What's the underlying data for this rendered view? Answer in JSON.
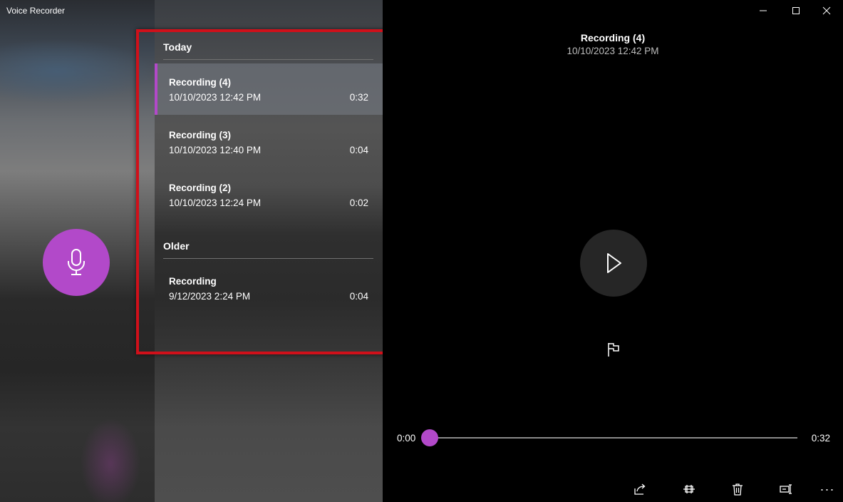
{
  "app": {
    "title": "Voice Recorder"
  },
  "colors": {
    "accent": "#b249c9",
    "highlight": "#d0101a",
    "background": "#000000"
  },
  "icons": {
    "record": "microphone-icon",
    "play": "play-icon",
    "flag": "flag-icon",
    "share": "share-icon",
    "trim": "trim-icon",
    "delete": "delete-icon",
    "rename": "rename-icon",
    "more": "more-icon"
  },
  "list": {
    "groups": [
      {
        "header": "Today",
        "items": [
          {
            "name": "Recording (4)",
            "date": "10/10/2023 12:42 PM",
            "duration": "0:32",
            "selected": true
          },
          {
            "name": "Recording (3)",
            "date": "10/10/2023 12:40 PM",
            "duration": "0:04",
            "selected": false
          },
          {
            "name": "Recording (2)",
            "date": "10/10/2023 12:24 PM",
            "duration": "0:02",
            "selected": false
          }
        ]
      },
      {
        "header": "Older",
        "items": [
          {
            "name": "Recording",
            "date": "9/12/2023 2:24 PM",
            "duration": "0:04",
            "selected": false
          }
        ]
      }
    ]
  },
  "player": {
    "title": "Recording (4)",
    "date": "10/10/2023 12:42 PM",
    "time_current": "0:00",
    "time_total": "0:32",
    "progress": 0,
    "more_label": "···"
  }
}
